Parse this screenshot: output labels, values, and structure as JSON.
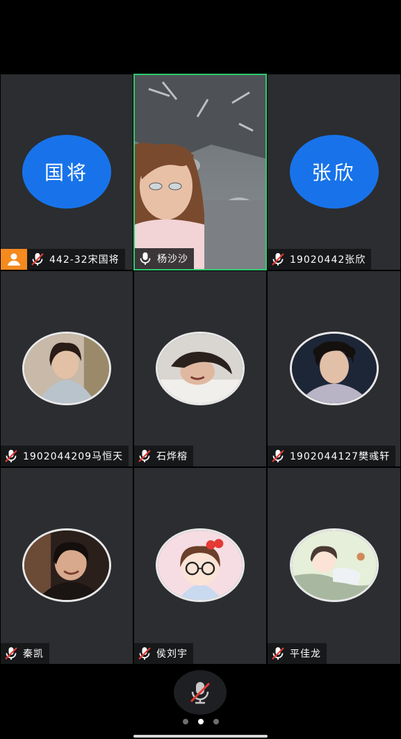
{
  "participants": [
    {
      "name": "442-32宋国将",
      "avatar_text": "国将",
      "is_host": true,
      "muted": true
    },
    {
      "name": "杨沙沙",
      "video_on": true,
      "speaking": true,
      "muted": false
    },
    {
      "name": "19020442张欣",
      "avatar_text": "张欣",
      "muted": true
    },
    {
      "name": "1902044209马恒天",
      "muted": true
    },
    {
      "name": "石烨榕",
      "muted": true
    },
    {
      "name": "1902044127樊彧轩",
      "muted": true
    },
    {
      "name": "秦凯",
      "muted": true
    },
    {
      "name": "侯刘宇",
      "muted": true
    },
    {
      "name": "平佳龙",
      "muted": true
    }
  ],
  "colors": {
    "avatar_blue": "#1873ea",
    "host_orange": "#f58a1f",
    "speaking_green": "#2ecc71",
    "mute_red": "#e53935",
    "tile_bg": "#2b2d30"
  },
  "controls": {
    "self_mic": "muted",
    "pages_total": 3,
    "current_page": 2
  }
}
